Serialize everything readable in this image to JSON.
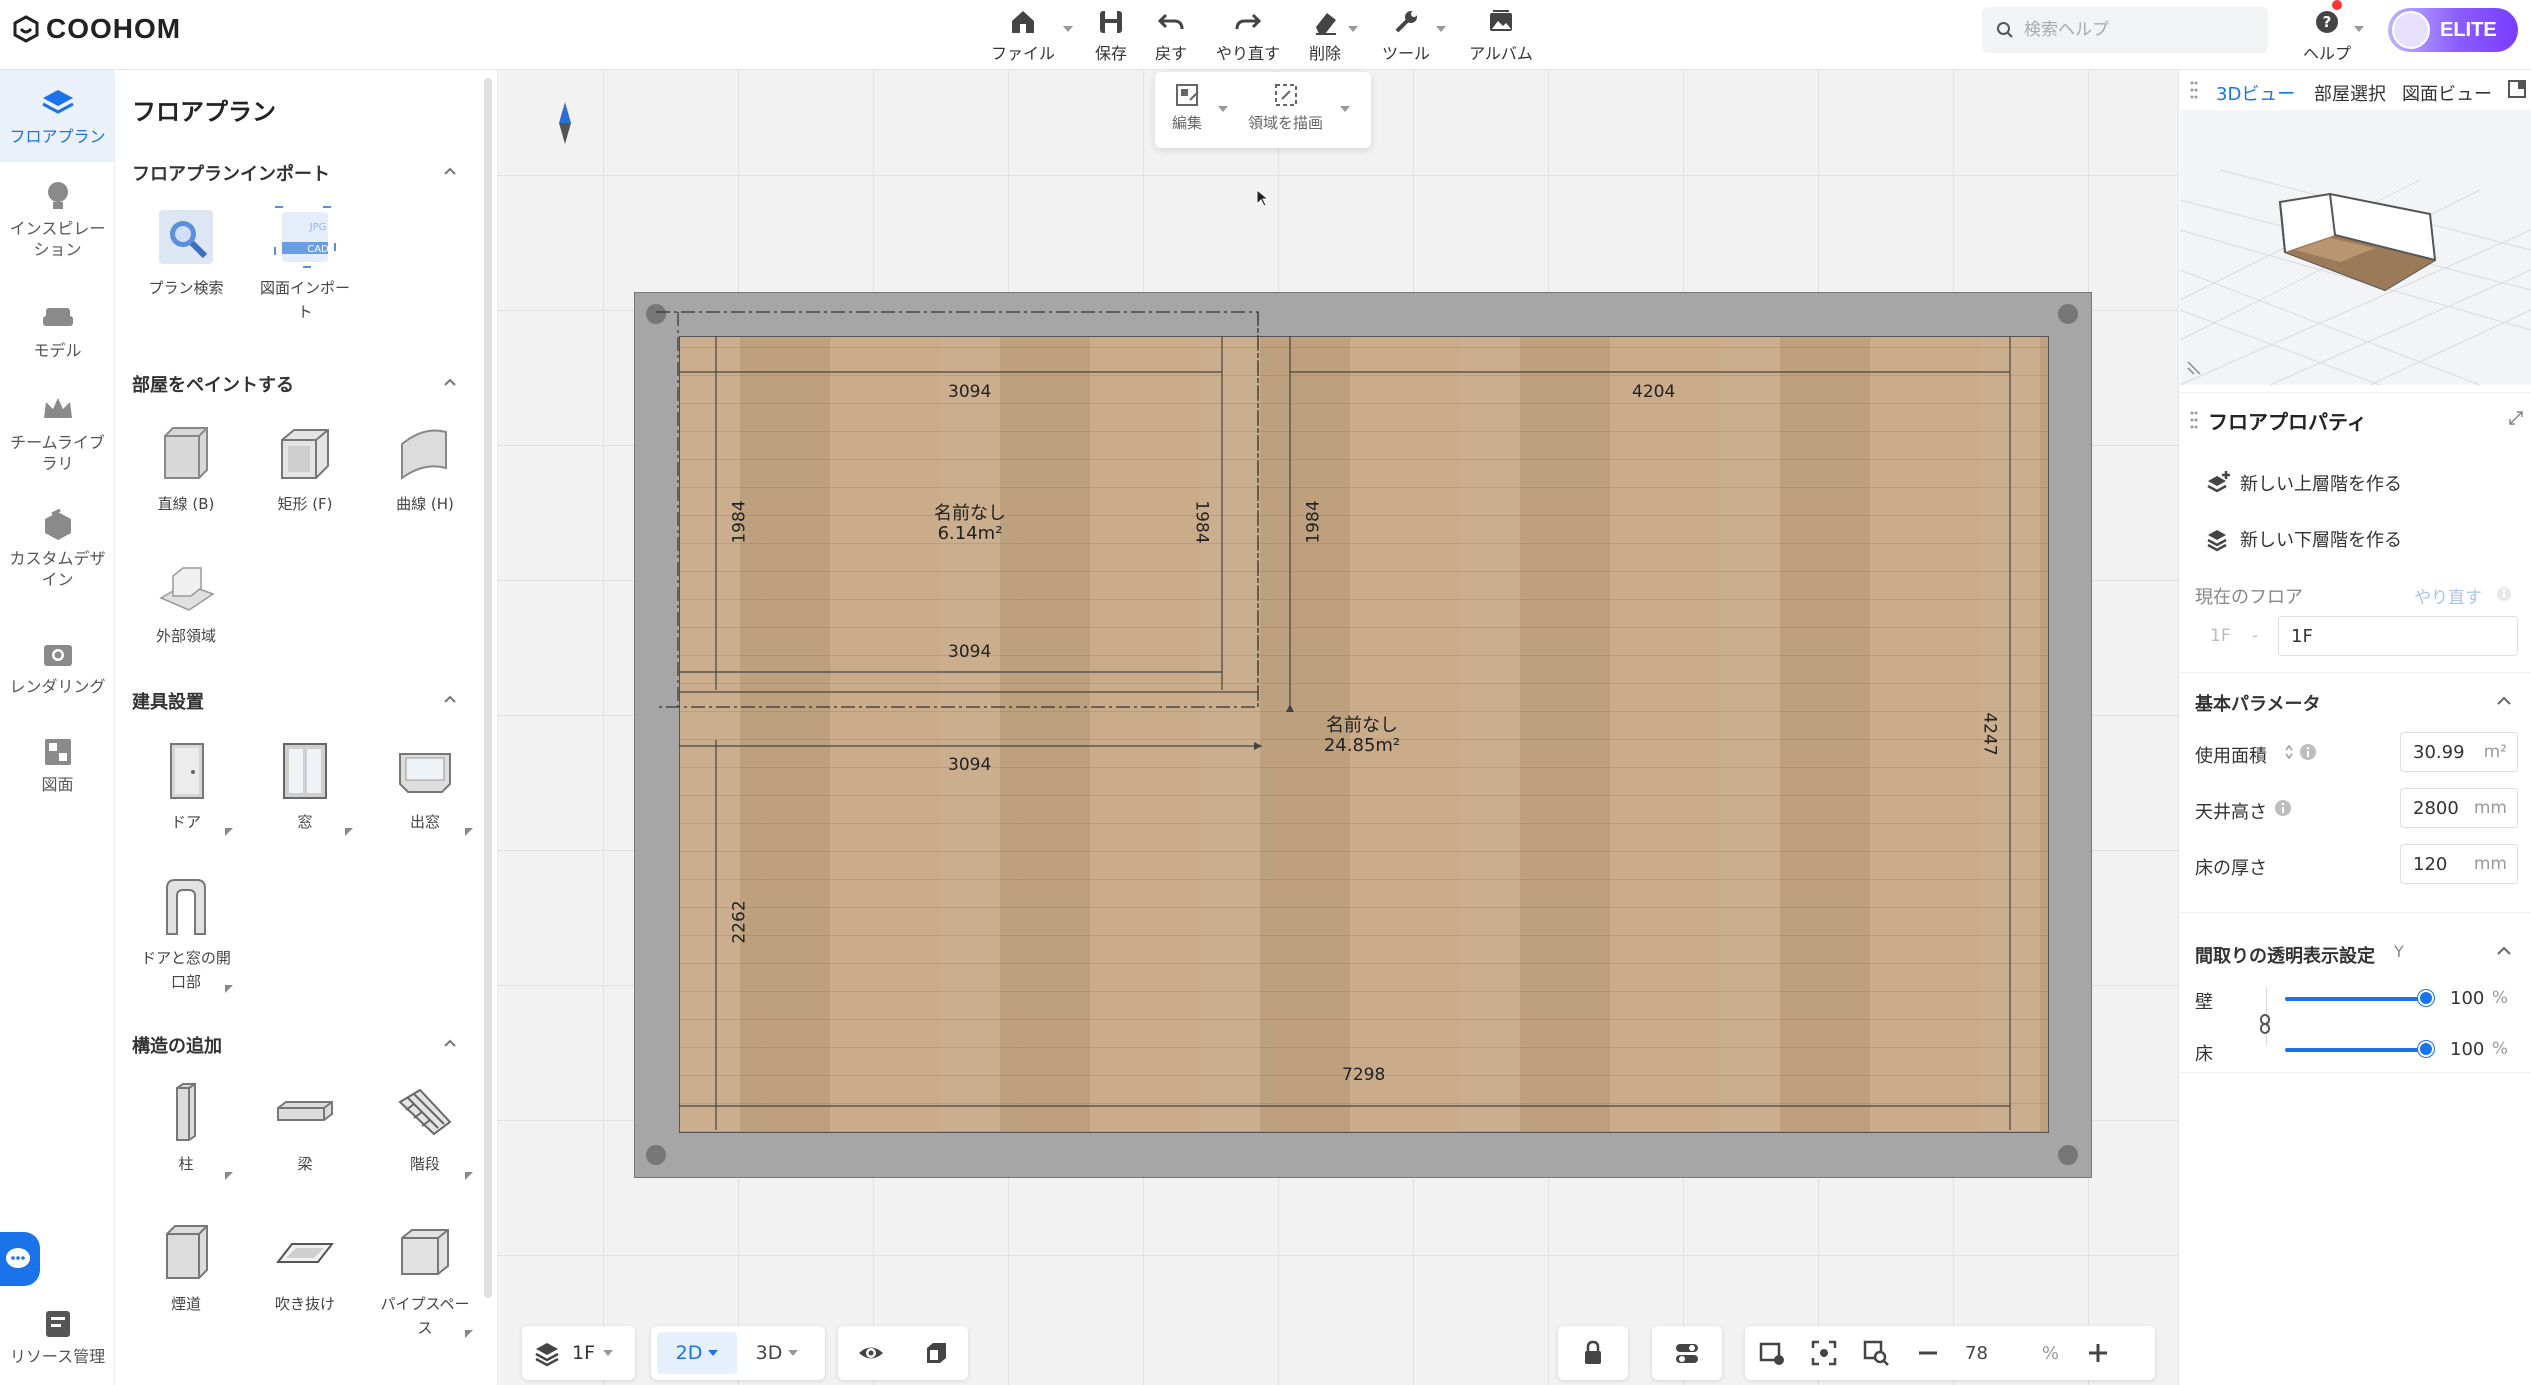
{
  "app": {
    "logo_text": "COOHOM"
  },
  "toolbar": {
    "file": "ファイル",
    "save": "保存",
    "undo": "戻す",
    "redo": "やり直す",
    "delete": "削除",
    "tools": "ツール",
    "album": "アルバム"
  },
  "subtoolbar": {
    "edit": "編集",
    "draw_area": "領域を描画"
  },
  "search": {
    "placeholder": "検索ヘルプ"
  },
  "help": {
    "label": "ヘルプ"
  },
  "account": {
    "badge": "ELITE"
  },
  "rail": [
    {
      "label": "フロアプラン",
      "icon": "floorplan-icon",
      "selected": true
    },
    {
      "label": "インスピレーション",
      "icon": "lightbulb-icon"
    },
    {
      "label": "モデル",
      "icon": "sofa-icon"
    },
    {
      "label": "チームライブラリ",
      "icon": "crown-icon"
    },
    {
      "label": "カスタムデザイン",
      "icon": "custom-design-icon"
    },
    {
      "label": "レンダリング",
      "icon": "camera-icon"
    },
    {
      "label": "図面",
      "icon": "drawing-icon"
    },
    {
      "label": "リソース管理",
      "icon": "resource-icon"
    }
  ],
  "left_panel": {
    "title": "フロアプラン",
    "sections": {
      "import": {
        "title": "フロアプランインポート",
        "items": [
          "プラン検索",
          "図面インポート"
        ]
      },
      "paint": {
        "title": "部屋をペイントする",
        "items": [
          "直線 (B)",
          "矩形 (F)",
          "曲線 (H)",
          "外部領域"
        ]
      },
      "fixtures": {
        "title": "建具設置",
        "items": [
          "ドア",
          "窓",
          "出窓",
          "ドアと窓の開口部"
        ]
      },
      "structure": {
        "title": "構造の追加",
        "items": [
          "柱",
          "梁",
          "階段",
          "煙道",
          "吹き抜け",
          "パイプスペース"
        ]
      }
    },
    "import_thumb_text": {
      "jpg": "JPG",
      "cad": "CAD"
    }
  },
  "plan": {
    "dims": {
      "top_left": "3094",
      "top_right": "4204",
      "mid_left_1": "3094",
      "mid_left_2": "3094",
      "bottom": "7298",
      "v_left_top": "1984",
      "v_mid_a": "1984",
      "v_mid_b": "1984",
      "v_left_bottom": "2262",
      "v_right": "4247"
    },
    "rooms": [
      {
        "name": "名前なし",
        "area": "6.14m²"
      },
      {
        "name": "名前なし",
        "area": "24.85m²"
      }
    ]
  },
  "bottom_bar": {
    "floor": "1F",
    "mode_2d": "2D",
    "mode_3d": "3D",
    "zoom": "78",
    "zoom_unit": "%"
  },
  "right_panel": {
    "tabs": [
      "3Dビュー",
      "部屋選択",
      "図面ビュー"
    ],
    "active_tab": 0,
    "floor_props": {
      "title": "フロアプロパティ",
      "new_upper": "新しい上層階を作る",
      "new_lower": "新しい下層階を作る",
      "current_floor_label": "現在のフロア",
      "redo_link": "やり直す",
      "floor_code": "1F",
      "floor_name": "1F"
    },
    "basic": {
      "title": "基本パラメータ",
      "area_label": "使用面積",
      "area_value": "30.99",
      "area_unit": "m²",
      "ceiling_label": "天井高さ",
      "ceiling_value": "2800",
      "ceiling_unit": "mm",
      "thickness_label": "床の厚さ",
      "thickness_value": "120",
      "thickness_unit": "mm"
    },
    "transparency": {
      "title": "間取りの透明表示設定",
      "y_label": "Y",
      "wall_label": "壁",
      "wall_value": "100",
      "floor_label": "床",
      "floor_value": "100",
      "unit": "%"
    }
  },
  "colors": {
    "accent": "#1a73e8",
    "elite_start": "#c0b3ff",
    "elite_end": "#7a3cff",
    "floor_wood": "#c7a884",
    "wall": "#a6a6a6"
  }
}
